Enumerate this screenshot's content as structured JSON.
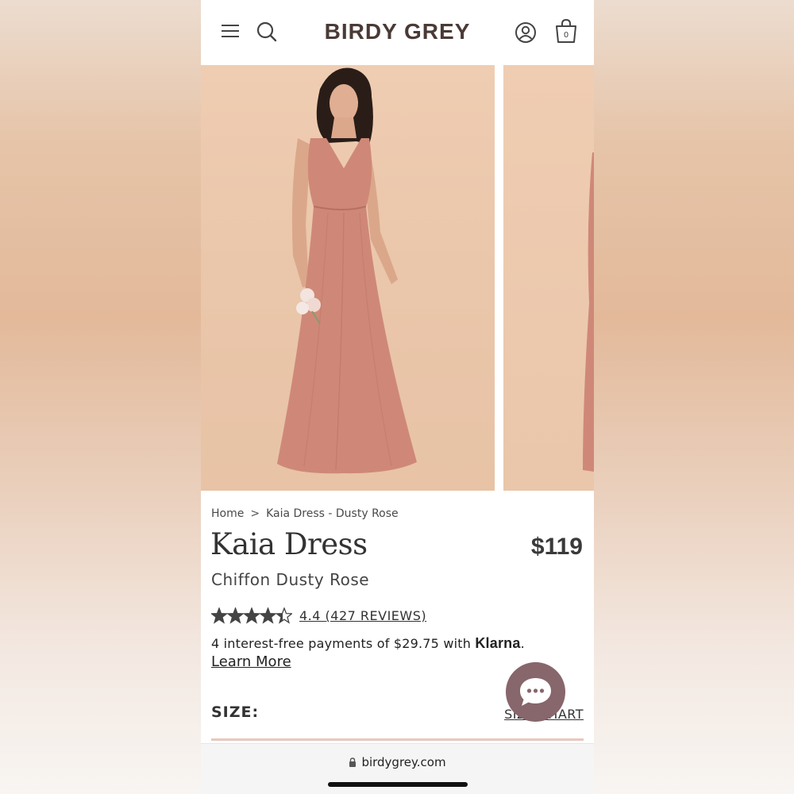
{
  "header": {
    "logo": "BIRDY GREY",
    "cart_count": "0",
    "icons": [
      "menu-icon",
      "search-icon",
      "account-icon",
      "cart-icon"
    ]
  },
  "breadcrumb": {
    "home": "Home",
    "separator": ">",
    "current": "Kaia Dress - Dusty Rose"
  },
  "product": {
    "title": "Kaia Dress",
    "price": "$119",
    "subtitle": "Chiffon Dusty Rose",
    "rating": 4.4,
    "rating_text": "4.4 (427 REVIEWS)",
    "stars_max": 5
  },
  "klarna": {
    "text": "4 interest-free payments of $29.75 with ",
    "brand": "Klarna",
    "suffix": ".",
    "learn_more": "Learn More"
  },
  "size": {
    "label": "SIZE:",
    "chart_link": "SIZE CHART"
  },
  "browser": {
    "url": "birdygrey.com"
  },
  "colors": {
    "brand": "#4a3a36",
    "chat_button": "#87666c",
    "dress": "#cf8878",
    "backdrop": "#eac6aa"
  }
}
